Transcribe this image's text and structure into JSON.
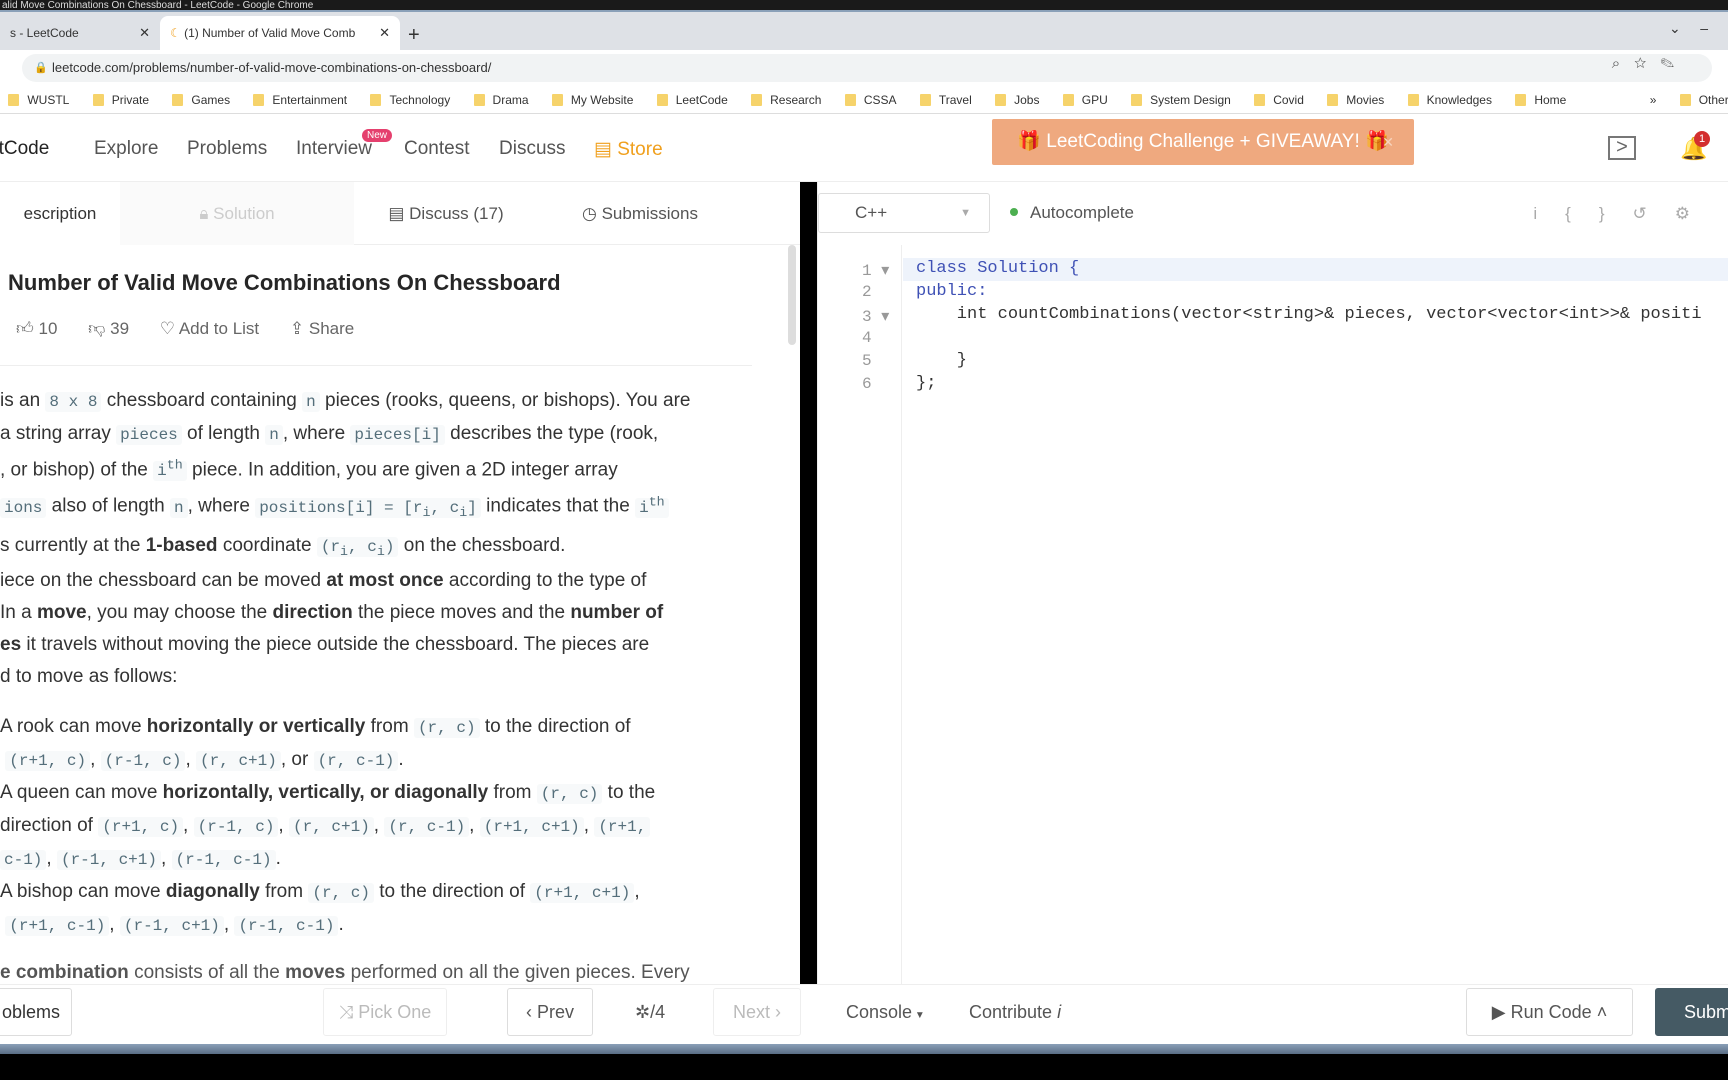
{
  "window_title": "alid Move Combinations On Chessboard - LeetCode - Google Chrome",
  "tabs": [
    {
      "label": "s - LeetCode"
    },
    {
      "label": "(1) Number of Valid Move Comb"
    }
  ],
  "url": "leetcode.com/problems/number-of-valid-move-combinations-on-chessboard/",
  "bookmarks": [
    "WUSTL",
    "Private",
    "Games",
    "Entertainment",
    "Technology",
    "Drama",
    "My Website",
    "LeetCode",
    "Research",
    "CSSA",
    "Travel",
    "Jobs",
    "GPU",
    "System Design",
    "Covid",
    "Movies",
    "Knowledges",
    "Home"
  ],
  "other_bookmarks": "Other bookmarks",
  "nav": {
    "logo": "etCode",
    "explore": "Explore",
    "problems": "Problems",
    "interview": "Interview",
    "new_badge": "New",
    "contest": "Contest",
    "discuss": "Discuss",
    "store": "Store",
    "banner": "LeetCoding Challenge + GIVEAWAY!",
    "notifications": "1"
  },
  "problem_tabs": {
    "description": "escription",
    "solution": "Solution",
    "discuss": "Discuss (17)",
    "submissions": "Submissions"
  },
  "problem": {
    "title": "Number of Valid Move Combinations On Chessboard",
    "likes": "10",
    "dislikes": "39",
    "add_to_list": "Add to List",
    "share": "Share"
  },
  "editor": {
    "language": "C++",
    "autocomplete": "Autocomplete",
    "lines": [
      "class Solution {",
      "public:",
      "    int countCombinations(vector<string>& pieces, vector<vector<int>>& positi",
      "",
      "    }",
      "};"
    ]
  },
  "bottom": {
    "problems": "oblems",
    "pick_one": "Pick One",
    "prev": "Prev",
    "page": "/4",
    "next": "Next",
    "console": "Console",
    "contribute": "Contribute",
    "run_code": "Run Code",
    "submit": "Subm"
  },
  "colors": {
    "accent_store": "#f0a01e",
    "banner": "#efa97f",
    "submit": "#455a64",
    "new_badge": "#e5406e"
  }
}
